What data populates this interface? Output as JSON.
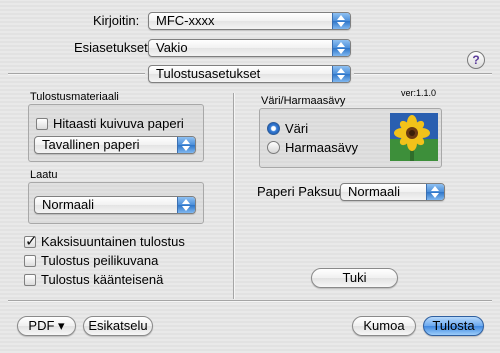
{
  "header": {
    "printer_label": "Kirjoitin:",
    "printer_value": "MFC-xxxx",
    "presets_label": "Esiasetukset:",
    "presets_value": "Vakio",
    "section_value": "Tulostusasetukset",
    "help_symbol": "?"
  },
  "media": {
    "group_label": "Tulostusmateriaali",
    "slow_drying_label": "Hitaasti kuivuva paperi",
    "slow_drying_checked": false,
    "media_type_value": "Tavallinen paperi"
  },
  "quality": {
    "group_label": "Laatu",
    "quality_value": "Normaali"
  },
  "color": {
    "group_label": "Väri/Harmaasävy",
    "version": "ver:1.1.0",
    "color_option": "Väri",
    "grayscale_option": "Harmaasävy",
    "selected": "Väri"
  },
  "paper_thickness": {
    "label": "Paperi Paksuus:",
    "value": "Normaali"
  },
  "options": {
    "bidirectional_label": "Kaksisuuntainen tulostus",
    "bidirectional_checked": true,
    "mirror_label": "Tulostus peilikuvana",
    "mirror_checked": false,
    "reverse_label": "Tulostus käänteisenä",
    "reverse_checked": false
  },
  "support_button": "Tuki",
  "footer": {
    "pdf_button": "PDF ▾",
    "preview_button": "Esikatselu",
    "cancel_button": "Kumoa",
    "print_button": "Tulosta"
  },
  "colors": {
    "primary_button": "#4a90e2",
    "popup_arrow": "#3a7fd6"
  }
}
